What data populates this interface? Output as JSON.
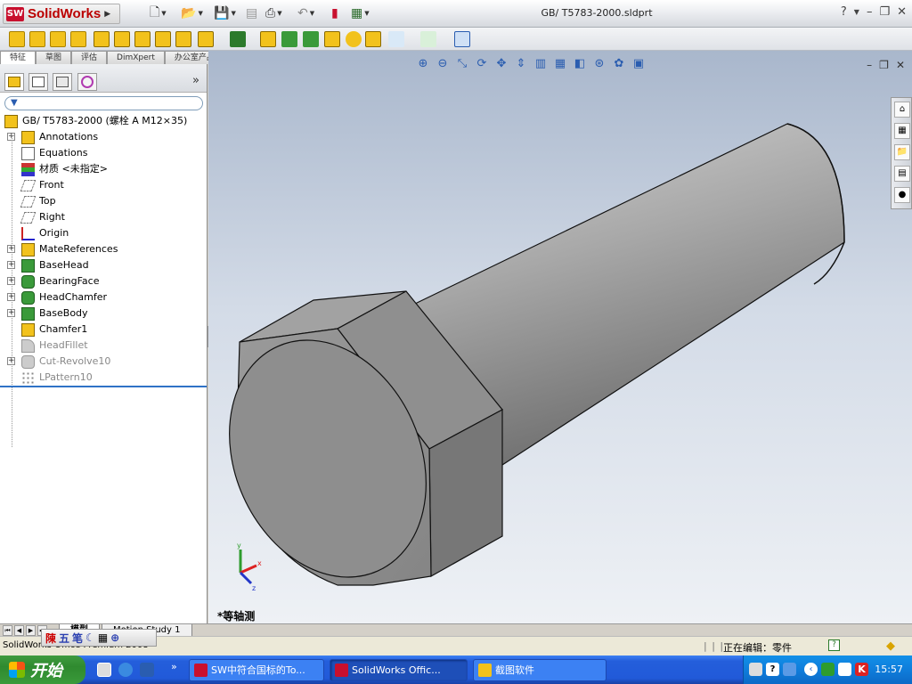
{
  "app": {
    "logo_badge": "SW",
    "name": "SolidWorks",
    "document_title": "GB/ T5783-2000.sldprt",
    "help": "?"
  },
  "tabs": [
    "特征",
    "草图",
    "评估",
    "DimXpert",
    "办公室产品"
  ],
  "tree": {
    "root": "GB/ T5783-2000 (螺栓  A M12×35)",
    "items": [
      {
        "label": "Annotations",
        "expandable": true,
        "dim": false,
        "icon": "annotations-icon"
      },
      {
        "label": "Equations",
        "expandable": false,
        "dim": false,
        "icon": "equations-icon"
      },
      {
        "label": "材质 <未指定>",
        "expandable": false,
        "dim": false,
        "icon": "material-icon"
      },
      {
        "label": "Front",
        "expandable": false,
        "dim": false,
        "icon": "plane-icon"
      },
      {
        "label": "Top",
        "expandable": false,
        "dim": false,
        "icon": "plane-icon"
      },
      {
        "label": "Right",
        "expandable": false,
        "dim": false,
        "icon": "plane-icon"
      },
      {
        "label": "Origin",
        "expandable": false,
        "dim": false,
        "icon": "origin-icon"
      },
      {
        "label": "MateReferences",
        "expandable": true,
        "dim": false,
        "icon": "mate-references-icon"
      },
      {
        "label": "BaseHead",
        "expandable": true,
        "dim": false,
        "icon": "extrude-icon"
      },
      {
        "label": "BearingFace",
        "expandable": true,
        "dim": false,
        "icon": "revolve-icon"
      },
      {
        "label": "HeadChamfer",
        "expandable": true,
        "dim": false,
        "icon": "revolve-icon"
      },
      {
        "label": "BaseBody",
        "expandable": true,
        "dim": false,
        "icon": "extrude-icon"
      },
      {
        "label": "Chamfer1",
        "expandable": false,
        "dim": false,
        "icon": "chamfer-icon"
      },
      {
        "label": "HeadFillet",
        "expandable": false,
        "dim": true,
        "icon": "fillet-icon"
      },
      {
        "label": "Cut-Revolve10",
        "expandable": true,
        "dim": true,
        "icon": "cut-revolve-icon"
      },
      {
        "label": "LPattern10",
        "expandable": false,
        "dim": true,
        "icon": "linear-pattern-icon"
      }
    ]
  },
  "viewport": {
    "view_label": "*等轴测",
    "triad": {
      "x": "x",
      "y": "y",
      "z": "z"
    }
  },
  "bottom_tabs": [
    "模型",
    "Motion Study 1"
  ],
  "status": {
    "left": "SolidWorks Office Premium 2008",
    "editing": "正在编辑：零件",
    "ime_chars": [
      "陳",
      "五",
      "笔"
    ]
  },
  "taskbar": {
    "start": "开始",
    "tasks": [
      "SW中符合国标的To...",
      "SolidWorks Offic...",
      "截图软件"
    ],
    "clock": "15:57"
  },
  "colors": {
    "sw_red": "#c8102e",
    "taskbar_blue": "#245edb",
    "start_green": "#3a9a3a",
    "rollback_bar": "#2f72c6"
  }
}
